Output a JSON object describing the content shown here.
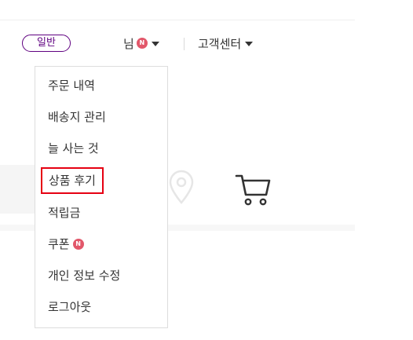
{
  "header": {
    "grade_badge": "일반",
    "user_name": "님",
    "new_marker": "N",
    "customer_center": "고객센터"
  },
  "dropdown": {
    "items": [
      {
        "label": "주문 내역"
      },
      {
        "label": "배송지 관리"
      },
      {
        "label": "늘 사는 것"
      },
      {
        "label": "상품 후기"
      },
      {
        "label": "적립금"
      },
      {
        "label": "쿠폰"
      },
      {
        "label": "개인 정보 수정"
      },
      {
        "label": "로그아웃"
      }
    ],
    "new_marker": "N"
  },
  "colors": {
    "brand": "#5f0080",
    "new_badge": "#e2576a",
    "highlight": "#e60012"
  },
  "icons": [
    "location-pin-icon",
    "cart-icon"
  ]
}
